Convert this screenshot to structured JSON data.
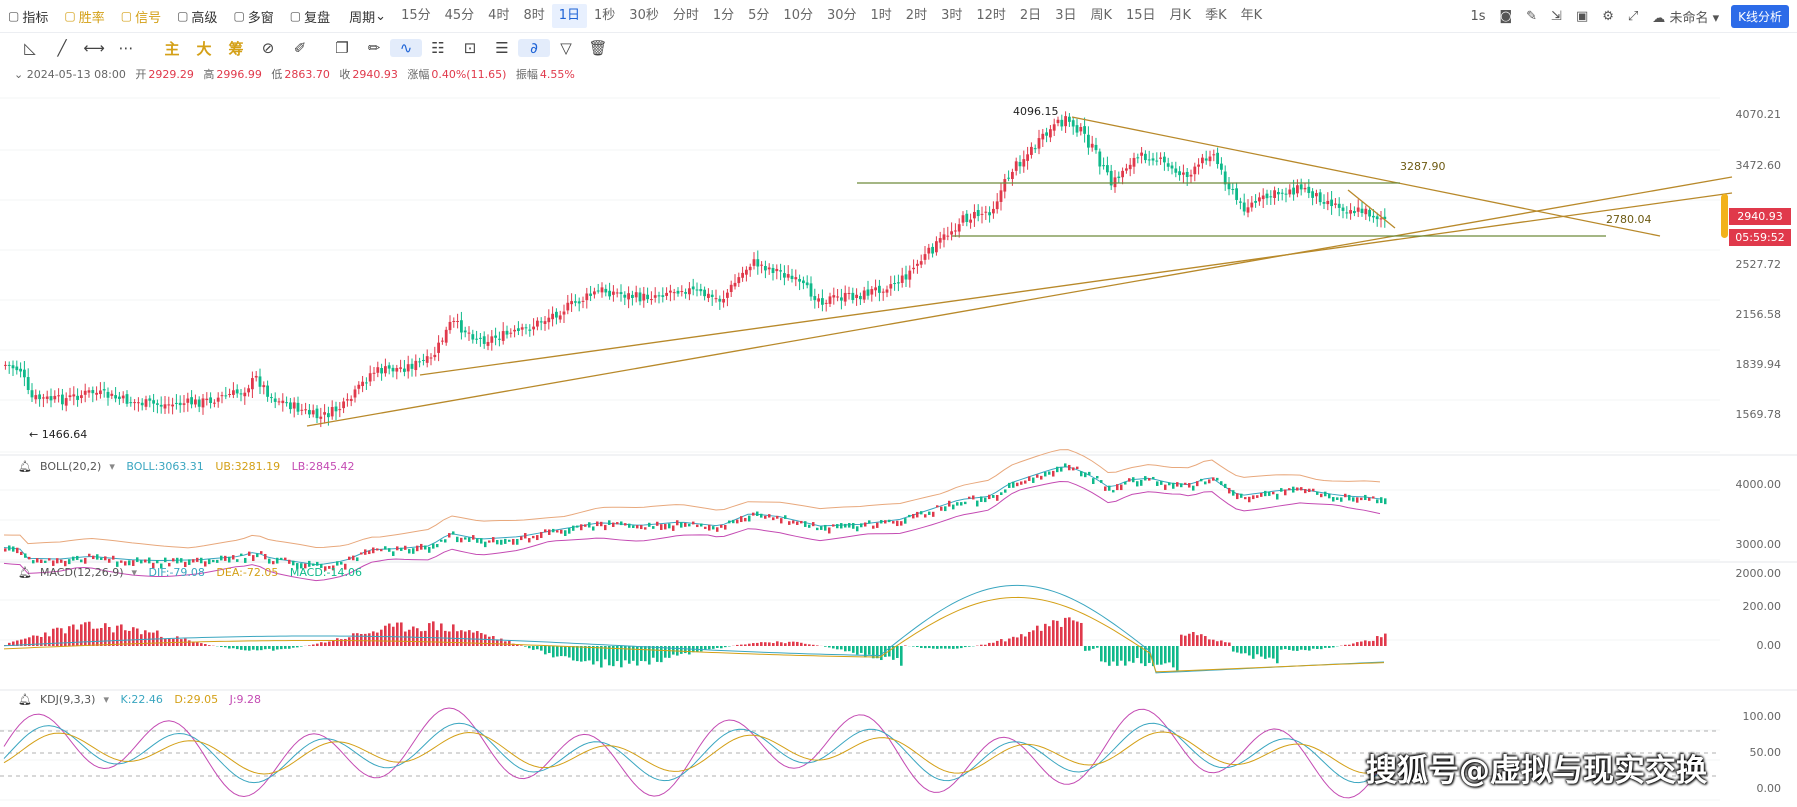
{
  "toolbar": {
    "items": [
      {
        "icon": "indicator-icon",
        "label": "指标",
        "gold": false
      },
      {
        "icon": "winrate-icon",
        "label": "胜率",
        "gold": true
      },
      {
        "icon": "signal-icon",
        "label": "信号",
        "gold": true
      },
      {
        "icon": "advanced-icon",
        "label": "高级",
        "gold": false
      },
      {
        "icon": "multiwindow-icon",
        "label": "多窗",
        "gold": false
      },
      {
        "icon": "replay-icon",
        "label": "复盘",
        "gold": false
      },
      {
        "icon": "chevron-down-icon",
        "label": "周期",
        "gold": false
      }
    ],
    "periods": [
      "15分",
      "45分",
      "4时",
      "8时",
      "1日",
      "1秒",
      "30秒",
      "分时",
      "1分",
      "5分",
      "10分",
      "30分",
      "1时",
      "2时",
      "3时",
      "12时",
      "2日",
      "3日",
      "周K",
      "15日",
      "月K",
      "季K",
      "年K"
    ],
    "active_period": "1日",
    "right": {
      "interval": "1s",
      "layout_name": "未命名",
      "kline_button": "K线分析"
    }
  },
  "drawing_tools": {
    "text_tools": [
      "主",
      "大",
      "筹"
    ]
  },
  "ohlc": {
    "date": "2024-05-13 08:00",
    "open_label": "开",
    "open": "2929.29",
    "high_label": "高",
    "high": "2996.99",
    "low_label": "低",
    "low": "2863.70",
    "close_label": "收",
    "close": "2940.93",
    "change_label": "涨幅",
    "change": "0.40%(11.65)",
    "amp_label": "振幅",
    "amp": "4.55%"
  },
  "price_axis": [
    "4070.21",
    "3472.60",
    "2527.72",
    "2156.58",
    "1839.94",
    "1569.78"
  ],
  "last_price": {
    "price": "2940.93",
    "countdown": "05:59:52"
  },
  "annotations": {
    "high": "4096.15",
    "low": "1466.64",
    "resistance": "3287.90",
    "support": "2780.04"
  },
  "boll": {
    "name": "BOLL(20,2)",
    "mid": "BOLL:3063.31",
    "ub": "UB:3281.19",
    "lb": "LB:2845.42",
    "axis": [
      "4000.00",
      "3000.00",
      "2000.00"
    ]
  },
  "macd": {
    "name": "MACD(12,26,9)",
    "dif": "DIF:-79.08",
    "dea": "DEA:-72.05",
    "macd": "MACD:-14.06",
    "axis": [
      "200.00",
      "0.00"
    ]
  },
  "kdj": {
    "name": "KDJ(9,3,3)",
    "k": "K:22.46",
    "d": "D:29.05",
    "j": "J:9.28",
    "axis": [
      "100.00",
      "50.00",
      "0.00"
    ]
  },
  "colors": {
    "up": "#e0394b",
    "down": "#0fb98a",
    "accent": "#1e63d6",
    "gold": "#d4a017",
    "trend": "#b8892a",
    "hline": "#6d8a3a"
  },
  "watermark": "搜狐号@虚拟与现实交换"
}
